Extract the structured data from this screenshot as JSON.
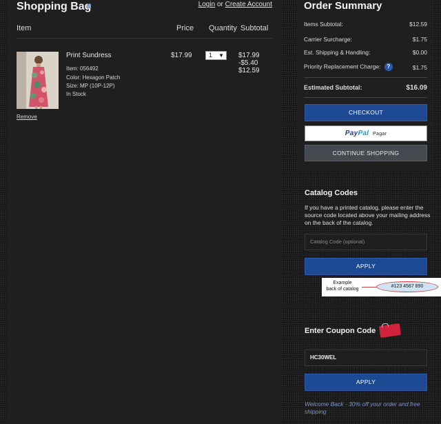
{
  "bag": {
    "title": "Shopping Bag",
    "login_label": "Login",
    "or_label": "or",
    "create_account_label": "Create Account",
    "headers": {
      "item": "Item",
      "price": "Price",
      "quantity": "Quantity",
      "subtotal": "Subtotal"
    },
    "item": {
      "name": "Print Sundress",
      "number": "Item: 056492",
      "color": "Color: Hexagon Patch",
      "size": "Size: MP (10P-12P)",
      "stock": "In Stock",
      "price": "$17.99",
      "quantity": "1",
      "subtotal_lines": [
        "$17.99",
        "-$5.40",
        "$12.59"
      ],
      "remove_label": "Remove"
    }
  },
  "summary": {
    "title": "Order Summary",
    "rows": [
      {
        "label": "Items Subtotal:",
        "value": "$12.59"
      },
      {
        "label": "Carrier Surcharge:",
        "value": "$1.75"
      },
      {
        "label": "Est. Shipping & Handling:",
        "value": "$0.00"
      },
      {
        "label": "Priority Replacement Charge:",
        "value": "$1.75"
      }
    ],
    "help_icon": "?",
    "estimated_label": "Estimated Subtotal:",
    "estimated_value": "$16.09",
    "checkout_label": "CHECKOUT",
    "paypal_brand_a": "Pay",
    "paypal_brand_b": "Pal",
    "paypal_suffix": "Pagar",
    "continue_label": "CONTINUE SHOPPING"
  },
  "catalog": {
    "title": "Catalog Codes",
    "description": "If you have a printed catalog, please enter the source code located above your mailing address on the back of the catalog.",
    "placeholder": "Catalog Code (optional)",
    "apply_label": "APPLY",
    "example_label_1": "Example",
    "example_label_2": "back of catalog",
    "example_number": "#123 4567 890"
  },
  "coupon": {
    "title": "Enter Coupon Code",
    "value": "HC30WEL",
    "apply_label": "APPLY",
    "welcome_text": "Welcome Back - 30% off your order and free shipping"
  },
  "colors": {
    "accent": "#1d4a93",
    "panel": "#1f1f1f",
    "link": "#7b96c8"
  }
}
